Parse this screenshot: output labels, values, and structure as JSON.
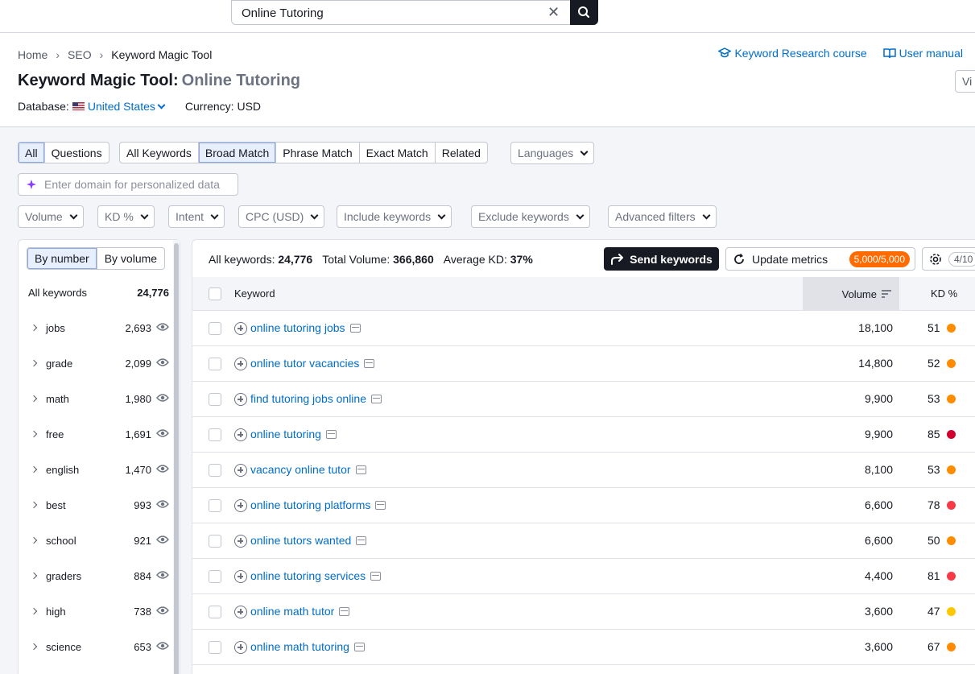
{
  "search": {
    "value": "Online Tutoring"
  },
  "breadcrumb": [
    "Home",
    "SEO",
    "Keyword Magic Tool"
  ],
  "toplinks": {
    "course": "Keyword Research course",
    "manual": "User manual"
  },
  "title": {
    "tool": "Keyword Magic Tool:",
    "query": "Online Tutoring"
  },
  "view_btn": "Vi",
  "database": {
    "label": "Database:",
    "value": "United States",
    "currency": "Currency: USD"
  },
  "match_tabs": {
    "all": "All",
    "questions": "Questions"
  },
  "match_types": [
    "All Keywords",
    "Broad Match",
    "Phrase Match",
    "Exact Match",
    "Related"
  ],
  "languages": "Languages",
  "domain_placeholder": "Enter domain for personalized data",
  "filters": [
    "Volume",
    "KD %",
    "Intent",
    "CPC (USD)",
    "Include keywords",
    "Exclude keywords",
    "Advanced filters"
  ],
  "sidebar": {
    "toggle": [
      "By number",
      "By volume"
    ],
    "all_label": "All keywords",
    "all_count": "24,776",
    "groups": [
      {
        "label": "jobs",
        "count": "2,693"
      },
      {
        "label": "grade",
        "count": "2,099"
      },
      {
        "label": "math",
        "count": "1,980"
      },
      {
        "label": "free",
        "count": "1,691"
      },
      {
        "label": "english",
        "count": "1,470"
      },
      {
        "label": "best",
        "count": "993"
      },
      {
        "label": "school",
        "count": "921"
      },
      {
        "label": "graders",
        "count": "884"
      },
      {
        "label": "high",
        "count": "738"
      },
      {
        "label": "science",
        "count": "653"
      }
    ]
  },
  "stats": {
    "all_label": "All keywords:",
    "all_value": "24,776",
    "vol_label": "Total Volume:",
    "vol_value": "366,860",
    "kd_label": "Average KD:",
    "kd_value": "37%"
  },
  "actions": {
    "send": "Send keywords",
    "update": "Update metrics",
    "credits": "5,000/5,000",
    "columns": "4/10"
  },
  "table": {
    "headers": {
      "keyword": "Keyword",
      "volume": "Volume",
      "kd": "KD %"
    },
    "rows": [
      {
        "keyword": "online tutoring jobs",
        "volume": "18,100",
        "kd": "51",
        "kd_color": "#ff8c00"
      },
      {
        "keyword": "online tutor vacancies",
        "volume": "14,800",
        "kd": "52",
        "kd_color": "#ff8c00"
      },
      {
        "keyword": "find tutoring jobs online",
        "volume": "9,900",
        "kd": "53",
        "kd_color": "#ff8c00"
      },
      {
        "keyword": "online tutoring",
        "volume": "9,900",
        "kd": "85",
        "kd_color": "#d1002f"
      },
      {
        "keyword": "vacancy online tutor",
        "volume": "8,100",
        "kd": "53",
        "kd_color": "#ff8c00"
      },
      {
        "keyword": "online tutoring platforms",
        "volume": "6,600",
        "kd": "78",
        "kd_color": "#f73a45"
      },
      {
        "keyword": "online tutors wanted",
        "volume": "6,600",
        "kd": "50",
        "kd_color": "#ff8c00"
      },
      {
        "keyword": "online tutoring services",
        "volume": "4,400",
        "kd": "81",
        "kd_color": "#f73a45"
      },
      {
        "keyword": "online math tutor",
        "volume": "3,600",
        "kd": "47",
        "kd_color": "#ffc700"
      },
      {
        "keyword": "online math tutoring",
        "volume": "3,600",
        "kd": "67",
        "kd_color": "#ff8c00"
      }
    ]
  },
  "colors": {
    "accent": "#006dca",
    "dark": "#171a22",
    "badge": "#ff6b00"
  }
}
